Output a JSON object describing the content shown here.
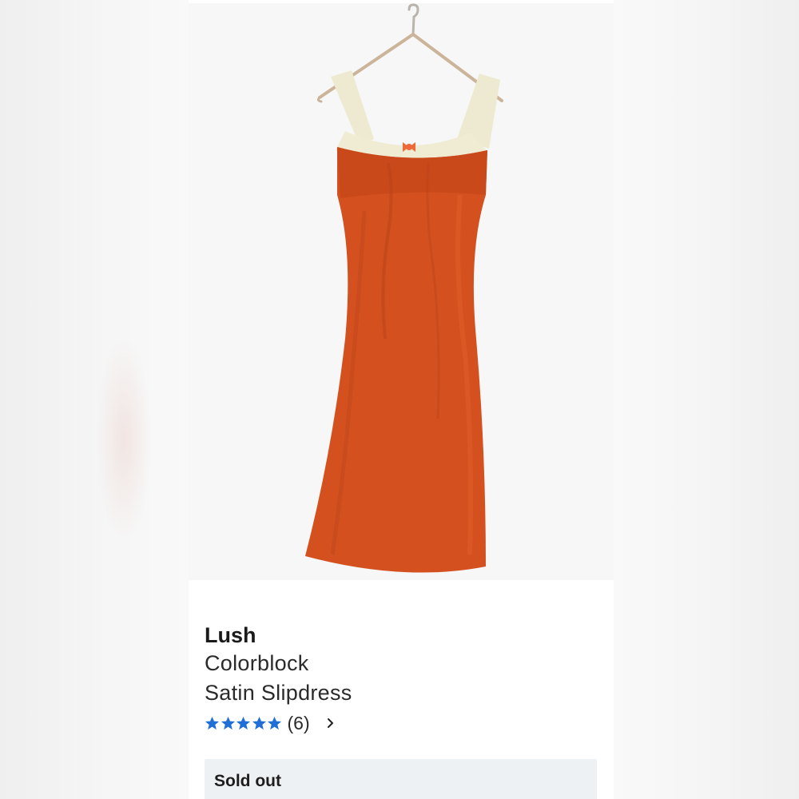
{
  "product": {
    "image_alt": "orange satin slip dress on hanger",
    "brand": "Lush",
    "name_line1": "Colorblock",
    "name_line2": "Satin Slipdress",
    "rating": 5,
    "rating_max": 5,
    "review_count": "(6)",
    "status_label": "Sold out"
  },
  "colors": {
    "dress": "#d4501f",
    "dress_shadow": "#b8421a",
    "straps": "#eeead1",
    "star": "#1f6fd6",
    "soldout_bg": "#eef1f3"
  },
  "icons": {
    "rating_stars": "star-icon",
    "review_link": "chevron-right-icon",
    "hanger": "hanger-icon"
  }
}
